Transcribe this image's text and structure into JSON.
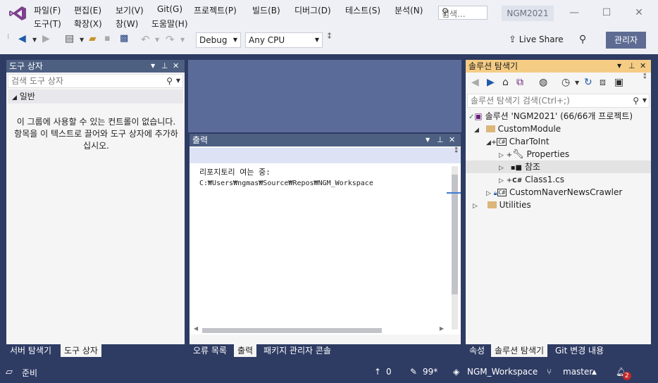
{
  "menu": [
    "파일(F)",
    "편집(E)",
    "보기(V)",
    "Git(G)",
    "프로젝트(P)",
    "빌드(B)",
    "디버그(D)",
    "테스트(S)",
    "분석(N)",
    "도구(T)",
    "확장(X)",
    "창(W)",
    "도움말(H)"
  ],
  "search": {
    "placeholder": "검색..."
  },
  "project_name": "NGM2021",
  "toolbar": {
    "config": "Debug",
    "platform": "Any CPU",
    "live_share": "Live Share",
    "admin": "관리자"
  },
  "toolbox": {
    "title": "도구 상자",
    "search_placeholder": "검색 도구 상자",
    "group": "일반",
    "empty_message": "이 그룹에 사용할 수 있는 컨트롤이 없습니다. 항목을 이 텍스트로 끌어와 도구 상자에 추가하십시오."
  },
  "output": {
    "title": "출력",
    "lines": [
      "리포지토리 여는 중:",
      "C:₩Users₩ngmas₩Source₩Repos₩NGM_Workspace"
    ]
  },
  "solution_explorer": {
    "title": "솔루션 탐색기",
    "search_placeholder": "솔루션 탐색기 검색(Ctrl+;)",
    "tree": {
      "solution": "솔루션 'NGM2021' (66/66개 프로젝트)",
      "custommodule": "CustomModule",
      "chartoint": "CharToInt",
      "properties": "Properties",
      "references": "참조",
      "class1": "Class1.cs",
      "crawler": "CustomNaverNewsCrawler",
      "utilities": "Utilities"
    }
  },
  "left_tabs": [
    "서버 탐색기",
    "도구 상자"
  ],
  "center_tabs": [
    "오류 목록",
    "출력",
    "패키지 관리자 콘솔"
  ],
  "right_tabs": [
    "속성",
    "솔루션 탐색기",
    "Git 변경 내용"
  ],
  "status": {
    "ready": "준비",
    "up": "0",
    "changes": "99*",
    "repo": "NGM_Workspace",
    "branch": "master",
    "notifications": "2"
  },
  "colors": {
    "titlebar": "#eef0f5",
    "chrome": "#2e3b63",
    "panel_header": "#4d6082",
    "active_header": "#f5cc84",
    "workspace": "#5b6b99"
  }
}
